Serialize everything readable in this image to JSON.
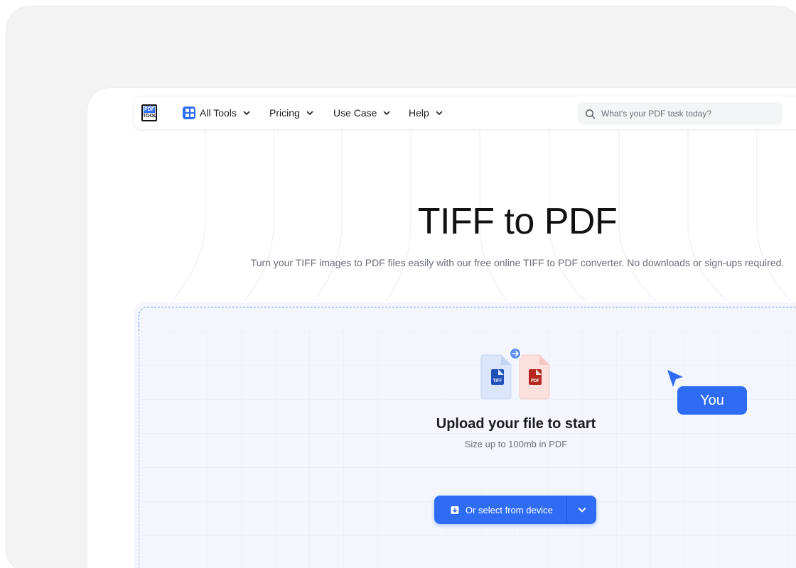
{
  "navbar": {
    "logo_text_top": "PDF",
    "logo_text_bottom": "TOOL",
    "items": [
      {
        "label": "All Tools",
        "icon": "apps-icon"
      },
      {
        "label": "Pricing"
      },
      {
        "label": "Use Case"
      },
      {
        "label": "Help"
      }
    ],
    "search_placeholder": "What's your PDF task today?"
  },
  "hero": {
    "title": "TIFF to PDF",
    "subtitle": "Turn your TIFF images to PDF files easily with our free online TIFF to PDF converter. No downloads or sign-ups required."
  },
  "upload": {
    "source_badge": "TIFF",
    "target_badge": "PDF",
    "title": "Upload your file to start",
    "subtitle": "Size up to 100mb in PDF",
    "select_label": "Or select from device"
  },
  "cursor": {
    "label": "You"
  },
  "colors": {
    "accent": "#2f6cf6",
    "upload_bg": "#f3f7fd",
    "tiff_icon": "#1f4fb8",
    "pdf_icon": "#b4271e"
  }
}
